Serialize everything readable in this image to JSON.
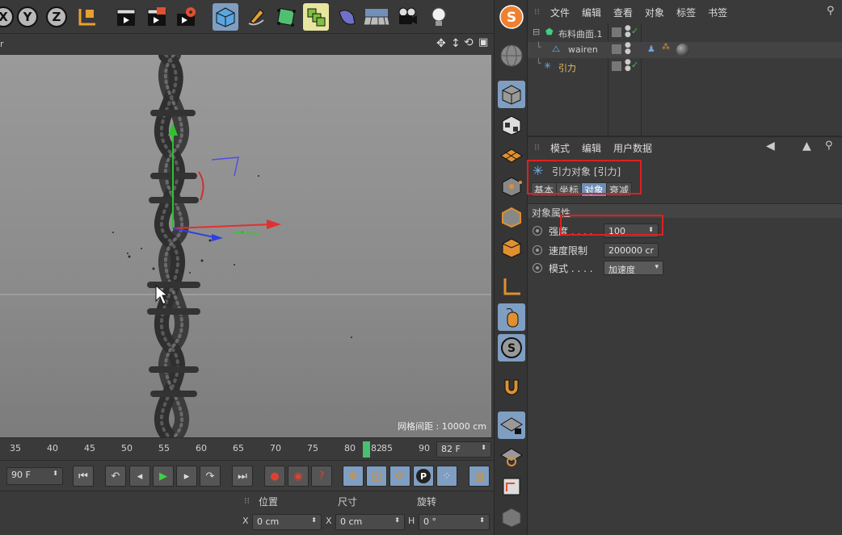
{
  "toolbar": {
    "axis_x": "X",
    "axis_y": "Y",
    "axis_z": "Z"
  },
  "viewport": {
    "grid_distance": "网格间距 : 10000 cm"
  },
  "timeline": {
    "ticks": [
      "35",
      "40",
      "45",
      "50",
      "55",
      "60",
      "65",
      "70",
      "75",
      "80",
      "85",
      "90"
    ],
    "current_frame_marker": "82",
    "current_frame_field": "82 F"
  },
  "playback": {
    "end_frame": "90 F"
  },
  "coords": {
    "position_label": "位置",
    "size_label": "尺寸",
    "rotation_label": "旋转",
    "pos_axis": "X",
    "pos_x_value": "0 cm",
    "size_axis": "X",
    "size_x_value": "0 cm",
    "rot_axis": "H",
    "rot_h_value": "0 °"
  },
  "object_manager": {
    "menu": [
      "文件",
      "编辑",
      "查看",
      "对象",
      "标签",
      "书签"
    ],
    "objects": [
      {
        "name": "布料曲面.1"
      },
      {
        "name": "wairen"
      },
      {
        "name": "引力"
      }
    ]
  },
  "attributes": {
    "menu": [
      "模式",
      "编辑",
      "用户数据"
    ],
    "object_title": "引力对象 [引力]",
    "tabs": [
      "基本",
      "坐标",
      "对象",
      "衰减"
    ],
    "active_tab": "对象",
    "section_title": "对象属性",
    "props": [
      {
        "label": "强度 . . . .",
        "value": "100"
      },
      {
        "label": "速度限制",
        "value": "200000 cr"
      },
      {
        "label": "模式 . . . .",
        "value": "加速度"
      }
    ]
  },
  "viewport_header_left": "r",
  "colors": {
    "highlight": "#7f9ec2",
    "annotation_red": "#e02020",
    "object_yellow": "#e8c060"
  }
}
